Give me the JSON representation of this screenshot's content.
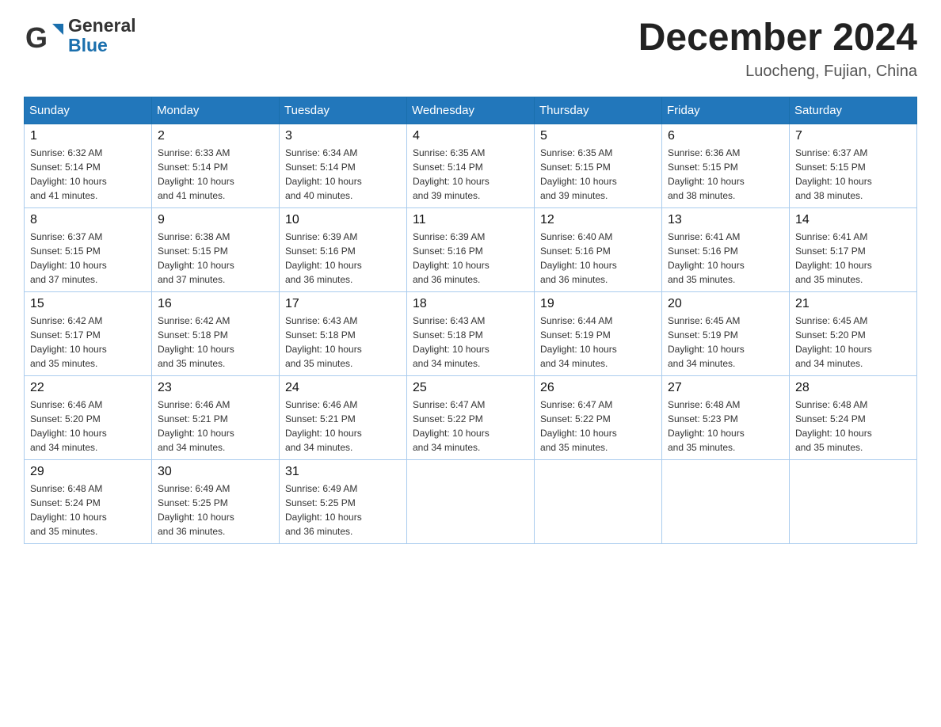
{
  "header": {
    "logo_general": "General",
    "logo_blue": "Blue",
    "title": "December 2024",
    "subtitle": "Luocheng, Fujian, China"
  },
  "days_of_week": [
    "Sunday",
    "Monday",
    "Tuesday",
    "Wednesday",
    "Thursday",
    "Friday",
    "Saturday"
  ],
  "weeks": [
    [
      {
        "num": "1",
        "sunrise": "6:32 AM",
        "sunset": "5:14 PM",
        "daylight": "10 hours and 41 minutes."
      },
      {
        "num": "2",
        "sunrise": "6:33 AM",
        "sunset": "5:14 PM",
        "daylight": "10 hours and 41 minutes."
      },
      {
        "num": "3",
        "sunrise": "6:34 AM",
        "sunset": "5:14 PM",
        "daylight": "10 hours and 40 minutes."
      },
      {
        "num": "4",
        "sunrise": "6:35 AM",
        "sunset": "5:14 PM",
        "daylight": "10 hours and 39 minutes."
      },
      {
        "num": "5",
        "sunrise": "6:35 AM",
        "sunset": "5:15 PM",
        "daylight": "10 hours and 39 minutes."
      },
      {
        "num": "6",
        "sunrise": "6:36 AM",
        "sunset": "5:15 PM",
        "daylight": "10 hours and 38 minutes."
      },
      {
        "num": "7",
        "sunrise": "6:37 AM",
        "sunset": "5:15 PM",
        "daylight": "10 hours and 38 minutes."
      }
    ],
    [
      {
        "num": "8",
        "sunrise": "6:37 AM",
        "sunset": "5:15 PM",
        "daylight": "10 hours and 37 minutes."
      },
      {
        "num": "9",
        "sunrise": "6:38 AM",
        "sunset": "5:15 PM",
        "daylight": "10 hours and 37 minutes."
      },
      {
        "num": "10",
        "sunrise": "6:39 AM",
        "sunset": "5:16 PM",
        "daylight": "10 hours and 36 minutes."
      },
      {
        "num": "11",
        "sunrise": "6:39 AM",
        "sunset": "5:16 PM",
        "daylight": "10 hours and 36 minutes."
      },
      {
        "num": "12",
        "sunrise": "6:40 AM",
        "sunset": "5:16 PM",
        "daylight": "10 hours and 36 minutes."
      },
      {
        "num": "13",
        "sunrise": "6:41 AM",
        "sunset": "5:16 PM",
        "daylight": "10 hours and 35 minutes."
      },
      {
        "num": "14",
        "sunrise": "6:41 AM",
        "sunset": "5:17 PM",
        "daylight": "10 hours and 35 minutes."
      }
    ],
    [
      {
        "num": "15",
        "sunrise": "6:42 AM",
        "sunset": "5:17 PM",
        "daylight": "10 hours and 35 minutes."
      },
      {
        "num": "16",
        "sunrise": "6:42 AM",
        "sunset": "5:18 PM",
        "daylight": "10 hours and 35 minutes."
      },
      {
        "num": "17",
        "sunrise": "6:43 AM",
        "sunset": "5:18 PM",
        "daylight": "10 hours and 35 minutes."
      },
      {
        "num": "18",
        "sunrise": "6:43 AM",
        "sunset": "5:18 PM",
        "daylight": "10 hours and 34 minutes."
      },
      {
        "num": "19",
        "sunrise": "6:44 AM",
        "sunset": "5:19 PM",
        "daylight": "10 hours and 34 minutes."
      },
      {
        "num": "20",
        "sunrise": "6:45 AM",
        "sunset": "5:19 PM",
        "daylight": "10 hours and 34 minutes."
      },
      {
        "num": "21",
        "sunrise": "6:45 AM",
        "sunset": "5:20 PM",
        "daylight": "10 hours and 34 minutes."
      }
    ],
    [
      {
        "num": "22",
        "sunrise": "6:46 AM",
        "sunset": "5:20 PM",
        "daylight": "10 hours and 34 minutes."
      },
      {
        "num": "23",
        "sunrise": "6:46 AM",
        "sunset": "5:21 PM",
        "daylight": "10 hours and 34 minutes."
      },
      {
        "num": "24",
        "sunrise": "6:46 AM",
        "sunset": "5:21 PM",
        "daylight": "10 hours and 34 minutes."
      },
      {
        "num": "25",
        "sunrise": "6:47 AM",
        "sunset": "5:22 PM",
        "daylight": "10 hours and 34 minutes."
      },
      {
        "num": "26",
        "sunrise": "6:47 AM",
        "sunset": "5:22 PM",
        "daylight": "10 hours and 35 minutes."
      },
      {
        "num": "27",
        "sunrise": "6:48 AM",
        "sunset": "5:23 PM",
        "daylight": "10 hours and 35 minutes."
      },
      {
        "num": "28",
        "sunrise": "6:48 AM",
        "sunset": "5:24 PM",
        "daylight": "10 hours and 35 minutes."
      }
    ],
    [
      {
        "num": "29",
        "sunrise": "6:48 AM",
        "sunset": "5:24 PM",
        "daylight": "10 hours and 35 minutes."
      },
      {
        "num": "30",
        "sunrise": "6:49 AM",
        "sunset": "5:25 PM",
        "daylight": "10 hours and 36 minutes."
      },
      {
        "num": "31",
        "sunrise": "6:49 AM",
        "sunset": "5:25 PM",
        "daylight": "10 hours and 36 minutes."
      },
      null,
      null,
      null,
      null
    ]
  ]
}
